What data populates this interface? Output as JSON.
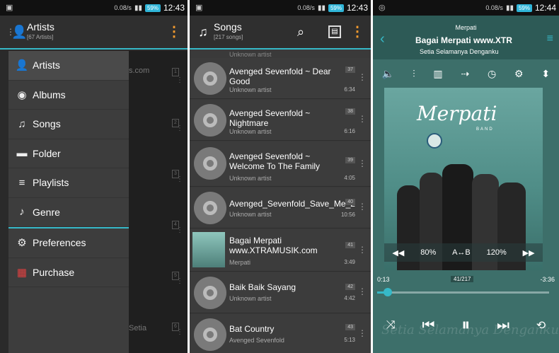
{
  "panel1": {
    "status": {
      "speed": "0.08/s",
      "battery": "59%",
      "time": "12:43"
    },
    "title": "Artists",
    "subtitle": "[67 Artists]",
    "drawer_items": [
      {
        "icon": "person-icon",
        "label": "Artists"
      },
      {
        "icon": "album-icon",
        "label": "Albums"
      },
      {
        "icon": "music-note-icon",
        "label": "Songs"
      },
      {
        "icon": "folder-icon",
        "label": "Folder"
      },
      {
        "icon": "playlist-icon",
        "label": "Playlists"
      },
      {
        "icon": "guitar-icon",
        "label": "Genre"
      }
    ],
    "drawer_secondary": [
      {
        "icon": "gear-icon",
        "label": "Preferences"
      },
      {
        "icon": "gift-icon",
        "label": "Purchase"
      }
    ],
    "behind_texts": {
      "top": "s.com",
      "bottom": "Setia"
    },
    "behind_numbers": [
      "1",
      "2",
      "3",
      "4",
      "5",
      "6"
    ]
  },
  "panel2": {
    "status": {
      "speed": "0.08/s",
      "battery": "59%",
      "time": "12:43"
    },
    "title": "Songs",
    "subtitle": "[217 songs]",
    "peek_artist": "Unknown artist",
    "songs": [
      {
        "title": "Avenged Sevenfold ~ Dear Good",
        "artist": "Unknown artist",
        "number": "37",
        "duration": "6:34"
      },
      {
        "title": "Avenged Sevenfold ~ Nightmare",
        "artist": "Unknown artist",
        "number": "38",
        "duration": "6:16"
      },
      {
        "title": "Avenged Sevenfold ~ Welcome To The Family",
        "artist": "Unknown artist",
        "number": "39",
        "duration": "4:05"
      },
      {
        "title": "Avenged_Sevenfold_Save_Me_2",
        "artist": "Unknown artist",
        "number": "40",
        "duration": "10:56"
      },
      {
        "title": "Bagai Merpati www.XTRAMUSIK.com",
        "artist": "Merpati",
        "number": "41",
        "duration": "3:49"
      },
      {
        "title": "Baik Baik Sayang",
        "artist": "Unknown artist",
        "number": "42",
        "duration": "4:42"
      },
      {
        "title": "Bat Country",
        "artist": "Avenged Sevenfold",
        "number": "43",
        "duration": "5:13"
      }
    ]
  },
  "panel3": {
    "status": {
      "speed": "0.08/s",
      "battery": "59%",
      "time": "12:44"
    },
    "artist": "Merpati",
    "song_title": "Bagai Merpati www.XTR",
    "album": "Setia Selamanya Denganku",
    "cover_logo": "Merpati",
    "cover_band": "BAND",
    "ab": {
      "left": "80%",
      "mid": "A↔B",
      "right": "120%"
    },
    "time_elapsed": "0:13",
    "track_position": "41/217",
    "time_remaining": "-3:36",
    "progress_fraction": 0.06,
    "watermark": "Setia Selamanya Denganku",
    "accent": "#36b9c8"
  }
}
